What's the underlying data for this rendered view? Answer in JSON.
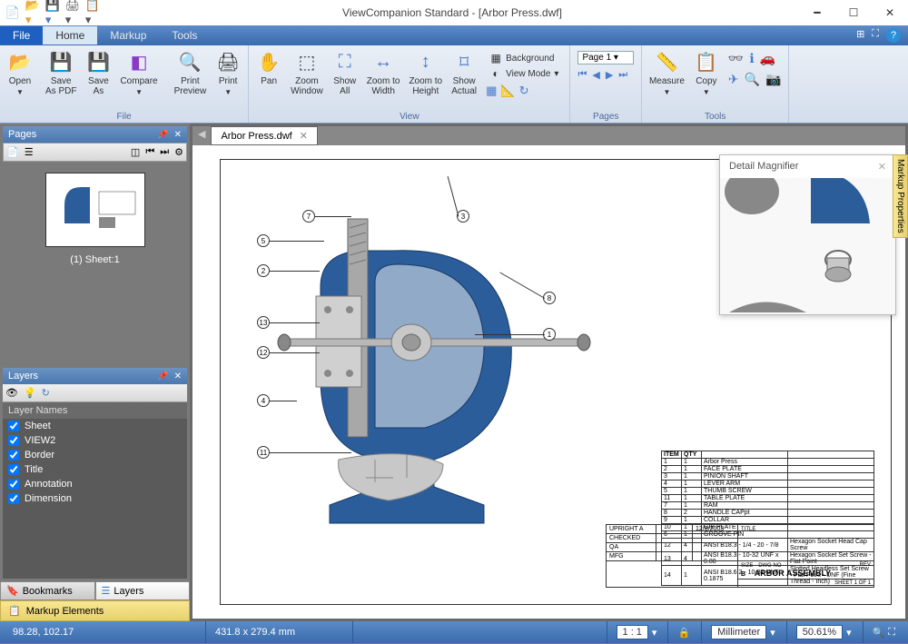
{
  "title": "ViewCompanion Standard - [Arbor Press.dwf]",
  "menu": {
    "file": "File",
    "home": "Home",
    "markup": "Markup",
    "tools": "Tools"
  },
  "ribbon": {
    "open": "Open",
    "save_pdf": "Save\nAs PDF",
    "save_as": "Save\nAs",
    "compare": "Compare",
    "print_preview": "Print\nPreview",
    "print": "Print",
    "pan": "Pan",
    "zoom_window": "Zoom\nWindow",
    "show_all": "Show\nAll",
    "zoom_width": "Zoom to\nWidth",
    "zoom_height": "Zoom to\nHeight",
    "show_actual": "Show\nActual",
    "background": "Background",
    "view_mode": "View Mode",
    "page_sel": "Page 1",
    "measure": "Measure",
    "copy": "Copy",
    "grp_file": "File",
    "grp_view": "View",
    "grp_pages": "Pages",
    "grp_tools": "Tools"
  },
  "pages_panel": {
    "title": "Pages",
    "thumb_label": "(1) Sheet:1"
  },
  "layers_panel": {
    "title": "Layers",
    "header": "Layer Names",
    "items": [
      "Sheet",
      "VIEW2",
      "Border",
      "Title",
      "Annotation",
      "Dimension"
    ]
  },
  "bottom_tabs": {
    "bookmarks": "Bookmarks",
    "layers": "Layers",
    "markup": "Markup Elements"
  },
  "doc_tab": "Arbor Press.dwf",
  "magnifier_title": "Detail Magnifier",
  "markup_props": "Markup Properties",
  "parts": {
    "headers": [
      "ITEM",
      "QTY"
    ],
    "rows": [
      [
        "1",
        "1",
        "Arbor Press",
        ""
      ],
      [
        "2",
        "1",
        "FACE PLATE",
        ""
      ],
      [
        "3",
        "1",
        "PINION SHAFT",
        ""
      ],
      [
        "4",
        "1",
        "LEVER ARM",
        ""
      ],
      [
        "5",
        "1",
        "THUMB SCREW",
        ""
      ],
      [
        "11",
        "1",
        "TABLE PLATE",
        ""
      ],
      [
        "7",
        "1",
        "RAM",
        ""
      ],
      [
        "8",
        "2",
        "HANDLE CAPpt",
        ""
      ],
      [
        "9",
        "1",
        "COLLAR",
        ""
      ],
      [
        "10",
        "1",
        "GIB PLATE",
        ""
      ],
      [
        "6",
        "1",
        "GROOVE PIN",
        ""
      ],
      [
        "12",
        "4",
        "ANSI B18.3 - 1/4 - 20 - 7/8",
        "Hexagon Socket Head Cap Screw"
      ],
      [
        "13",
        "4",
        "ANSI B18.3 - 10-32 UNF x 0.88",
        "Hexagon Socket Set Screw - Flat Point"
      ],
      [
        "14",
        "1",
        "ANSI B18.6.2 - 10-32 UNF - 0.1875",
        "Slotted Headless Set Screw - Flat Point - UNF (Fine Thread - Inch)"
      ]
    ]
  },
  "titleblock": {
    "upright": "UPRIGHT A",
    "date": "12/8/2003",
    "checked": "CHECKED",
    "qa": "QA",
    "mfg": "MFG",
    "title_lbl": "TITLE",
    "size_lbl": "SIZE",
    "size": "B",
    "dwgno_lbl": "DWG NO",
    "name": "ARBOR ASSEMBLY",
    "sheet": "SHEET 1 OF 1",
    "rev": "REV"
  },
  "status": {
    "coords": "98.28, 102.17",
    "dims": "431.8 x 279.4 mm",
    "scale": "1 : 1",
    "unit": "Millimeter",
    "zoom": "50.61%"
  }
}
